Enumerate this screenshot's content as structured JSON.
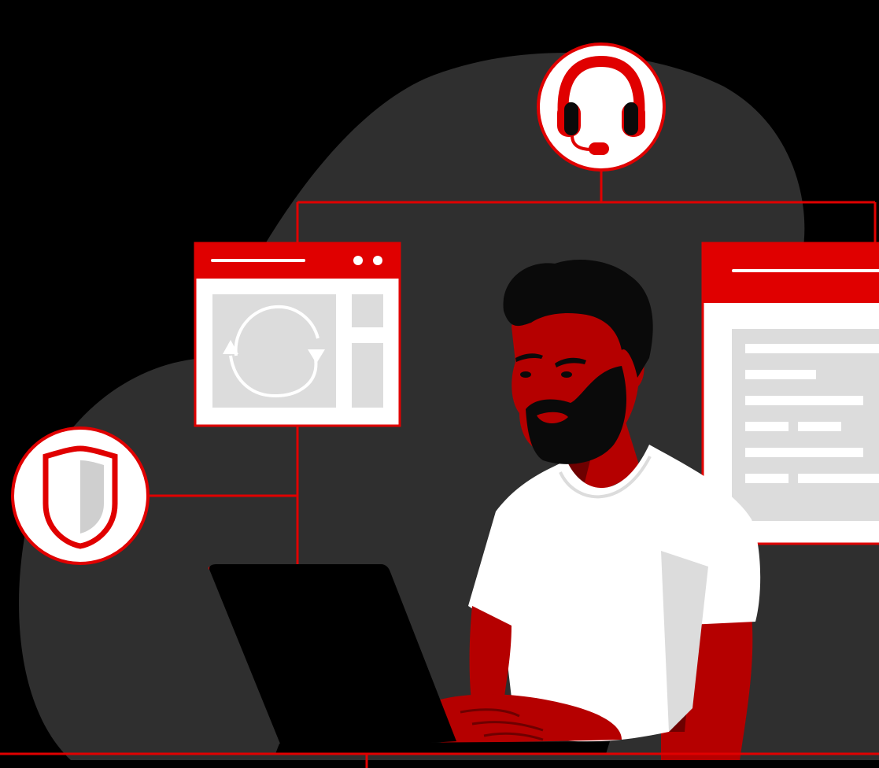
{
  "illustration": {
    "colors": {
      "background": "#000000",
      "cloud": "#2f2f2f",
      "accent": "#e00000",
      "skin": "#b50000",
      "skin_shadow": "#6e0000",
      "hair": "#0a0a0a",
      "shirt": "#ffffff",
      "shirt_shade": "#dcdcdc",
      "panel_gray": "#dcdcdc",
      "laptop": "#000000"
    },
    "icons": [
      "headset-icon",
      "sync-icon",
      "shield-icon",
      "document-lines-icon"
    ]
  }
}
